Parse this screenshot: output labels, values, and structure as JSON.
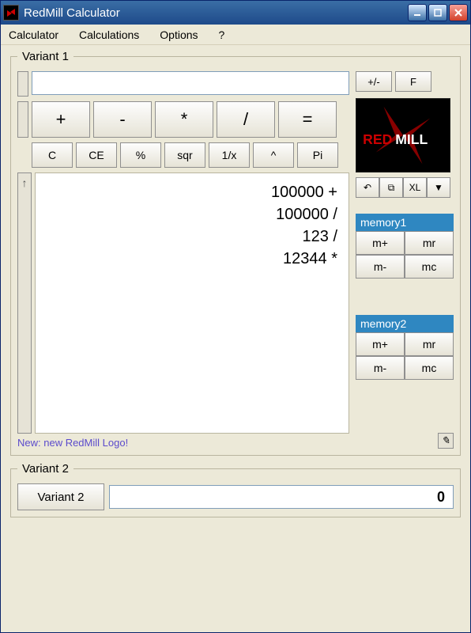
{
  "window": {
    "title": "RedMill Calculator"
  },
  "menu": {
    "calculator": "Calculator",
    "calculations": "Calculations",
    "options": "Options",
    "help": "?"
  },
  "variant1": {
    "legend": "Variant 1",
    "display_value": "",
    "plusminus": "+/-",
    "f": "F",
    "ops": {
      "plus": "+",
      "minus": "-",
      "mul": "*",
      "div": "/",
      "eq": "="
    },
    "funcs": {
      "c": "C",
      "ce": "CE",
      "pct": "%",
      "sqr": "sqr",
      "inv": "1/x",
      "pow": "^",
      "pi": "Pi"
    },
    "tape": [
      "100000 +",
      "100000 /",
      "123 /",
      "12344 *"
    ],
    "status": "New: new RedMill Logo!",
    "toolbar": {
      "undo": "↶",
      "copy": "⧉",
      "xl": "XL",
      "dd": "▼"
    }
  },
  "logo": {
    "text_red": "RED",
    "text_mill": "MILL"
  },
  "memory1": {
    "title": "memory1",
    "mplus": "m+",
    "mr": "mr",
    "mminus": "m-",
    "mc": "mc"
  },
  "memory2": {
    "title": "memory2",
    "mplus": "m+",
    "mr": "mr",
    "mminus": "m-",
    "mc": "mc"
  },
  "pencil": "✎",
  "variant2": {
    "legend": "Variant 2",
    "button": "Variant 2",
    "value": "0"
  }
}
